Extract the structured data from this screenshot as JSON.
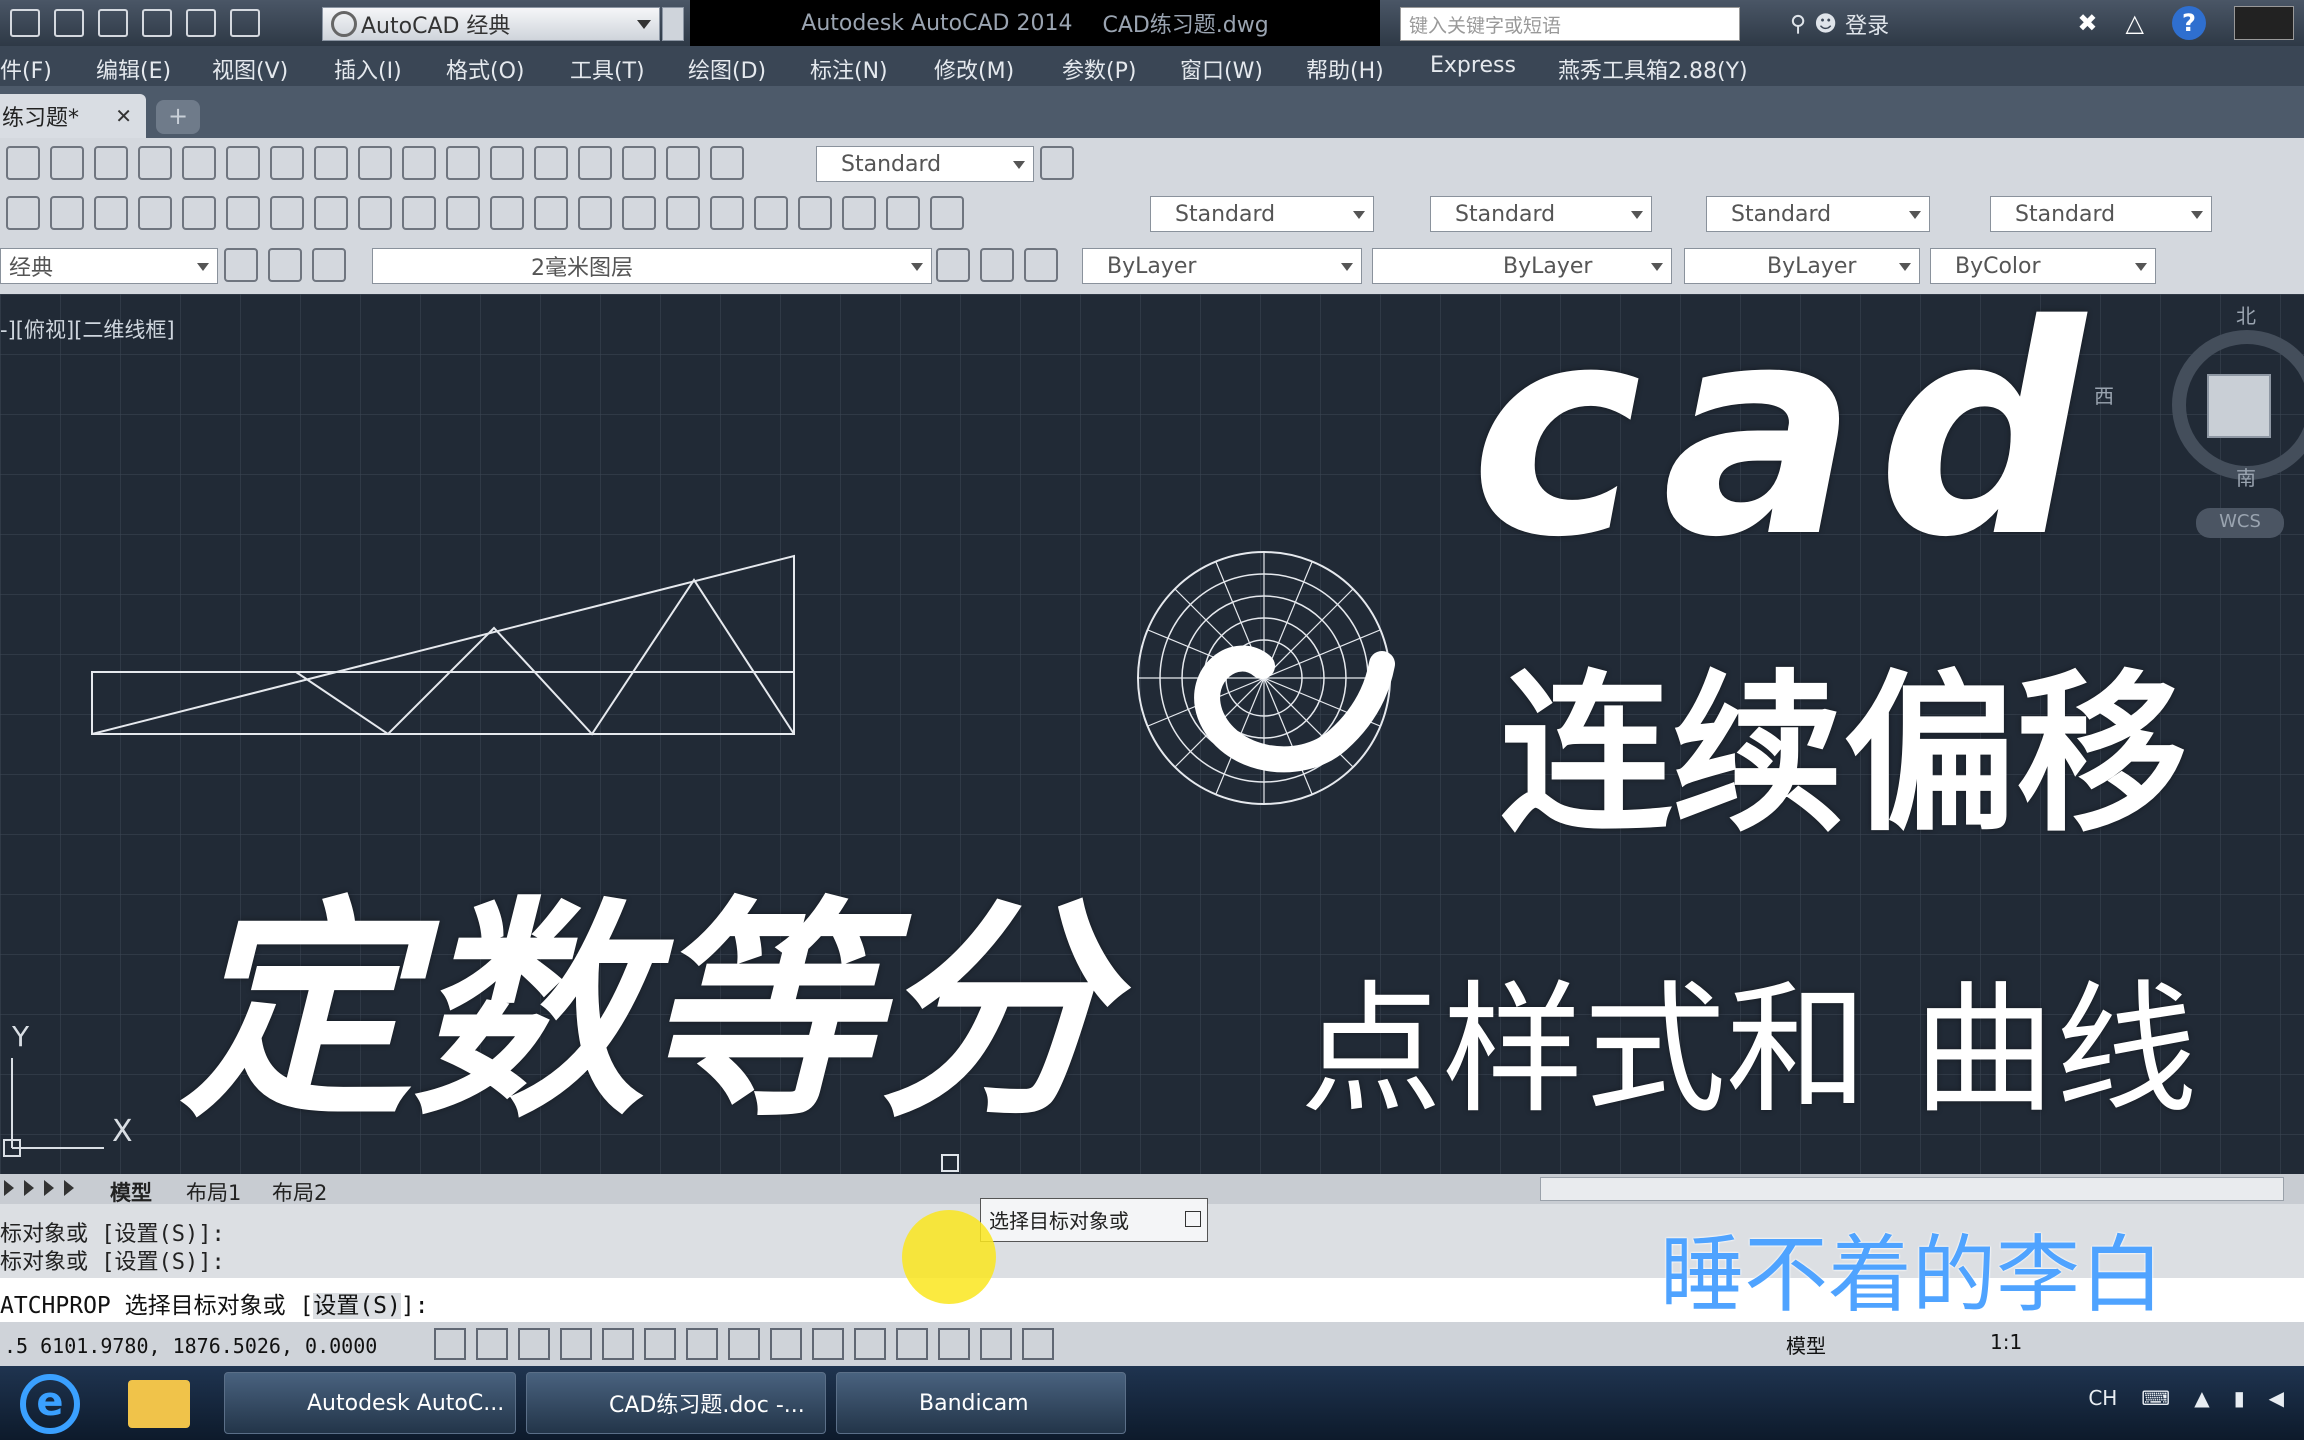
{
  "titlebar": {
    "workspace": "AutoCAD 经典",
    "app_title": "Autodesk AutoCAD 2014",
    "file_name": "CAD练习题.dwg",
    "search_placeholder": "键入关键字或短语",
    "login": "登录"
  },
  "menu": [
    "件(F)",
    "编辑(E)",
    "视图(V)",
    "插入(I)",
    "格式(O)",
    "工具(T)",
    "绘图(D)",
    "标注(N)",
    "修改(M)",
    "参数(P)",
    "窗口(W)",
    "帮助(H)",
    "Express",
    "燕秀工具箱2.88(Y)"
  ],
  "doc_tab": "练习题*",
  "toolbar": {
    "row1_style": "Standard",
    "row2_styles": [
      "Standard",
      "Standard",
      "Standard",
      "Standard"
    ],
    "workspace_short": "经典",
    "layer": "2毫米图层",
    "color": "ByLayer",
    "linetype": "ByLayer",
    "lineweight": "ByLayer",
    "plotstyle": "ByColor"
  },
  "canvas": {
    "view_label": "-][俯视][二维线框]",
    "compass": {
      "north": "北",
      "south": "南",
      "west": "西"
    },
    "wcs": "WCS",
    "ucs_x": "X",
    "ucs_y": "Y"
  },
  "overlay": {
    "cad": "cad",
    "offset": "连续偏移",
    "divide": "定数等分",
    "point_style": "点样式和 曲线"
  },
  "layout_tabs": [
    "模型",
    "布局1",
    "布局2"
  ],
  "command": {
    "history": [
      "标对象或 [设置(S)]:",
      "标对象或 [设置(S)]:"
    ],
    "prompt_prefix": "ATCHPROP 选择目标对象或 [",
    "prompt_option": "设置(S)",
    "prompt_suffix": "]:",
    "tooltip": "选择目标对象或"
  },
  "watermark": "睡不着的李白",
  "statusbar": {
    "coords": ".5  6101.9780, 1876.5026, 0.0000",
    "model": "模型",
    "scale": "1:1"
  },
  "taskbar": {
    "apps": [
      "Autodesk AutoC...",
      "CAD练习题.doc -...",
      "Bandicam"
    ],
    "tray_lang": "CH"
  }
}
